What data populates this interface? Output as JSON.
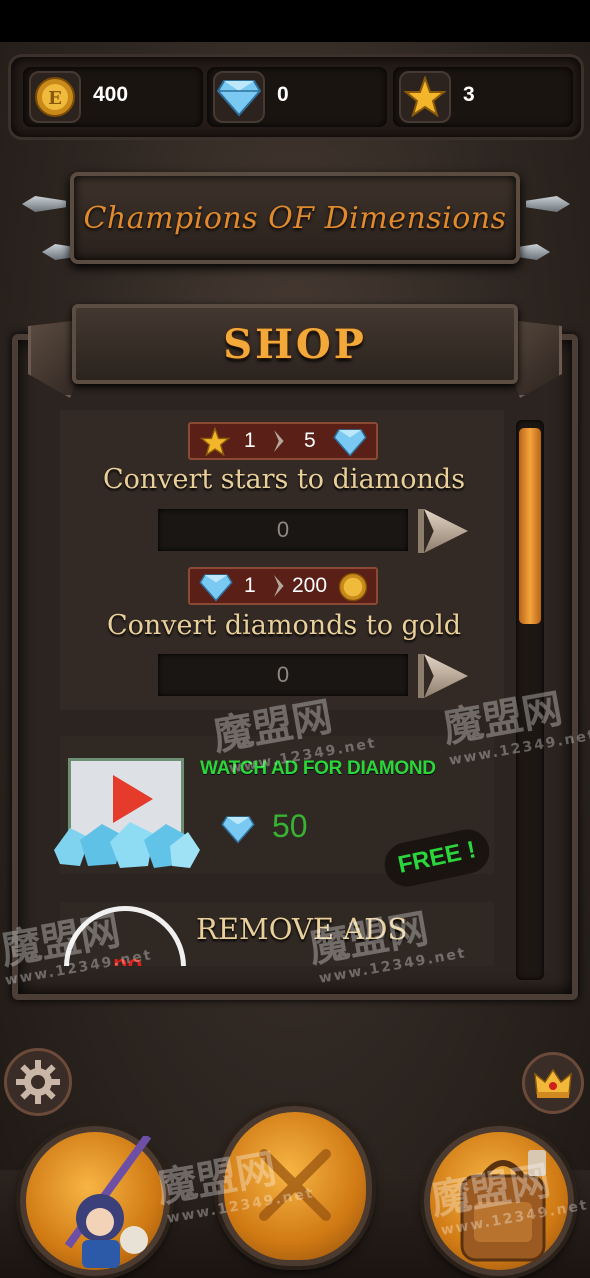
{
  "resources": {
    "gold": "400",
    "diamonds": "0",
    "stars": "3"
  },
  "logo": {
    "title": "Champions OF Dimensions"
  },
  "shop": {
    "title": "SHOP",
    "convert_stars": {
      "rate_from": "1",
      "rate_to": "5",
      "label": "Convert stars to diamonds",
      "input_value": "0"
    },
    "convert_diamonds": {
      "rate_from": "1",
      "rate_to": "200",
      "label": "Convert diamonds to gold",
      "input_value": "0"
    },
    "watch_ad": {
      "title": "WATCH AD FOR DIAMOND",
      "amount": "50",
      "badge": "FREE !"
    },
    "remove_ads": {
      "title": "REMOVE ADS",
      "icon_text": "no"
    }
  },
  "watermark": {
    "text": "魔盟网",
    "url": "www.12349.net"
  },
  "colors": {
    "accent_orange": "#f2a93a",
    "ad_green": "#2bd63a",
    "panel_brown": "#302823",
    "rate_plate": "#5a1f16"
  }
}
